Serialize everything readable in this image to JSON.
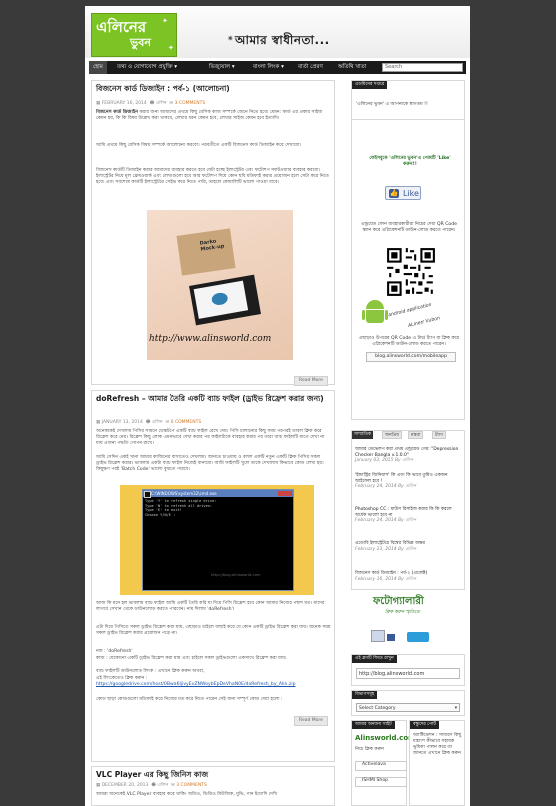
{
  "header": {
    "logo_text": "এলিনের",
    "logo_sub": "ভুবন",
    "tagline": "আমার স্বাধীনতা..."
  },
  "nav": {
    "items": [
      "হোম",
      "তথ্য ও যোগাযোগ প্রযুক্তি ▾",
      "ভিজ্যুয়াল ▾",
      "বাংলা লিংক ▾",
      "বার্তা প্রেরণ",
      "অতিথি খাতা"
    ],
    "search_placeholder": "Search"
  },
  "posts": [
    {
      "title": "বিজনেস কার্ড ডিজাইন : পর্ব-১ (আলোচনা)",
      "date": "FEBRUARY 16, 2014",
      "author": "এলিন",
      "comments": "3 COMMENTS",
      "p1_bold": "বিজনেস কার্ড ডিজাইন",
      "p1": " করার জন্য আমাদের প্রথমে কিছু বেসিক কাজ সম্পর্কে জেনে নিতে হবে। যেমন: কার্ড এর প্রকার সাইজ কেমন হয়, কি কি বিষয় উল্লেখ করা থাকবে, লেখার ধরন কেমন হবে, লেখার সাইজ কেমন হবে ইত্যাদি।",
      "p2": "আমি প্রথমে কিছু বেসিক বিষয় সম্পর্কে আলোচনা করবো। পরবর্তীতে একটি বিজনেস কার্ড ডিজাইন করে দেখাবো।",
      "p3": "বিজনেস কার্ডটি ডিজাইন করার আমাদের ব্যবহার করতে হবে যেটা হচ্ছে ইলাস্ট্রেটর এবং ফটোশপ সফটওয়্যার ব্যবহার করবো। ইলাস্ট্রেটর নিয়ে মূল ফ্রেমওয়ার্ক এবং লেখাগুলো হবে আর ফটোশপ দিয়ে কোন ছবি মডিফাই করার প্রয়োজন হলে সেটা করে নিতে হবে। এবং সবশেষে কার্ডটি ইলাস্ট্রেটরে সেইভ করে নিতে পারি, তাহলে কোয়ালিটি ভালো পাওয়া যাবে।",
      "p3_bold": "ইলাস্ট্রেটরে",
      "watermark": "http://www.alinsworld.com",
      "mock_label": "Darko\nMock-up",
      "readmore": "Read More"
    },
    {
      "title": "doRefresh – আমার তৈরি একটি ব্যাচ ফাইল (ড্রাইভ রিফ্রেশ করার জন্য)",
      "date": "JANUARY 13, 2014",
      "author": "এলিন",
      "comments": "6 COMMENTS",
      "p1": "অনেককেই দেখলাম পিসির সামনে ডেস্কটপে একটি ব্যাচ ফাইল রেখে দেয়। পিসি চালানোর কিছু সময় পরপরই ডাবল ক্লিক করে রিফ্রেশ করে নেয়। রিফ্রেশ কিছু লোক এমনভাবে দেখা করার পর ফাইলটাকে ব্যবহার করার পর তারা ব্যাচ ফাইলটি যাতে দেখা না যায় এজন্য পদ্ধতি গোপন রাখে।",
      "p2": "আমি সেদিন একই খানা আমার কাজিনের বাসাতেও দেখলাম। জানতে চাওয়ায় ও বলল একটি নতুন একটি ক্লিক পিসির সকল ড্রাইভ রিফ্রেশ করার। ভাবলাম একটা ব্যাচ ফাইল নিজেই বানাবো। আমি ফাইলটি খুলে তাকে দেখালাম কিভাবে কোড লেখা হয়। কিছুক্ষণ পরই 'Batch Code' ভালো বুঝতে পারবে।",
      "cmd_title": "C:\\WINDOWS\\system32\\cmd.exe",
      "cmd_lines": [
        "Type 'Y' to refresh single drive:",
        "Type 'N' to refresh all drives:",
        "Type 'E' to exit!",
        "Choose Y/N/E :"
      ],
      "cmd_watermark": "http://blog.alinsworld.com",
      "p3": "আজ কি মনে হল ভাবলাম ব্যাচ ফাইল আমি একটি তৈরি করি যা দিয়ে পিসি রিফ্রেশ হবে কোন আমার নিজের পছন্দ মত। যাদের লাগবে সেখান থেকে ডাউনলোড করতে পারবেন। নাম দিলাম 'doRefresh'।",
      "p4": "এটা দিয়ে পিসিতে সকল ড্রাইভ রিফ্রেশ করা যায়, এছাড়াও চাইলে বাছাই করে যে কোন একটি ড্রাইভ রিফ্রেশ করা যায়। অনেক সময় সকল ড্রাইভ রিফ্রেশ করার প্রয়োজন পড়ে না।",
      "name_line": "নাম : 'doRefresh'",
      "work_line": "কাজ : যেকোনো একটি ড্রাইভ রিফ্রেশ করা যায় এবং চাইলে সকল ড্রাইভগুলো একসাথে রিফ্রেশ করা যায়।",
      "download_line": "ব্যাচ ফাইলটি ডাউনলোড লিংক : এখানে ক্লিক করুন অথবা,",
      "alt_link_prefix": "এই লিংকেতেও ক্লিক করুন :",
      "alt_link": "https://googledrive.com/host/0Bwa6ljivyEvZNWoybEpDeVhaN0E/doRefresh_by_Alin.zip",
      "p5": "কোড ছাড়া কোডগুলো মডিফাই করে নিজের মত করে নিতে পারেন সেই জন্য সম্পূর্ণ কোড দেয়া হলো :",
      "readmore": "Read More"
    },
    {
      "title": "VLC Player এর কিছু জিনিস কাজ",
      "date": "DECEMBER 20, 2013",
      "author": "এলিন",
      "comments": "3 COMMENTS",
      "p1": "আমরা অনেকেই VLC Player ব্যবহার করে থাকি। অডিও, ভিডিও মিউজিক, মুভি, গান ইত্যাদি দেখি"
    }
  ],
  "sidebar": {
    "welcome_head": "এডমিনের দপ্তরে",
    "welcome_text": "'এলিনের ভুবন' এ আপনাকে স্বাগতম !!",
    "fb_text": "ফেইসবুকে 'এলিনের ভুবন'এ পেজটি 'Like' করুন!!",
    "like_label": "Like",
    "qr_text": "এন্ড্রয়েড ফোন ব্যবহারকারীরা নিচের দেয়া QR Code স্ক্যান করে এপ্লিকেশনটি ডাউন-লোড করতে পারেন।",
    "android_label": "android application",
    "android_name": "ALinerr Vubon",
    "qr_note": "এছাড়াও উপরের QR Code এ টাচ/ ট্যাপ বা ক্লিক করে এপ্লিকেশনটি ডাউন-লোড করতে পারেন।",
    "app_url": "blog.alinsworld.com/mobileapp",
    "tabs": [
      "সাম্প্রতিক",
      "জনপ্রিয়",
      "মন্তব্য",
      "ট্যাগ"
    ],
    "recent": [
      {
        "title": "আমার ডেভেলপ করা প্রথম এন্ড্রয়েড গেম: \"Depression Checker Bangla v.1.0.0\"",
        "date": "January 03, 2015 By এলিন"
      },
      {
        "title": "'ইন্ডাস্ট্রির জিনিয়াস' কি এবং কি ভাবে তুমিও একজন আইফেল হবে !",
        "date": "February 24, 2014 By এলিন"
      },
      {
        "title": "Photoshop CC : মাউস রিসাইজ করার কি কি করলে অর্ধেক ভালো হবে না",
        "date": "February 24, 2014 By এলিন"
      },
      {
        "title": "এডোবি ইলাস্ট্রেটরে বিশ্বের বিভিন্ন অক্ষর",
        "date": "February 23, 2014 By এলিন"
      },
      {
        "title": "বিজনেস কার্ড ডিজাইন : পর্ব-২ (প্রজেক্ট)",
        "date": "February 16, 2014 By এলিন"
      }
    ],
    "gallery_title": "ফটোগ্যালারী",
    "gallery_sub": "ক্লিক করুন স্মৃতিতে",
    "follow_head": "এই ব্লগটি ফিডে রাখুন",
    "follow_url": "http://blog.alinsworld.com",
    "cat_head": "বিভাগসমূহ",
    "cat_select": "Select Category",
    "friends_head": "আমার অন্যান্য সাইট",
    "friends": [
      "Alinsworld.com",
      "নিচে ক্লিক করুন",
      "Activelava",
      "ISHMI Shop"
    ],
    "news_head": "বন্ধুদের পোর্ট",
    "news_text": "অ্যাক্টিভেশন : সাধারণ কিছু যন্ত্রাংশ কীভাবে সহায়ক ভূমিকা পালন করে তা জানতে এখানে ক্লিক করুন"
  }
}
